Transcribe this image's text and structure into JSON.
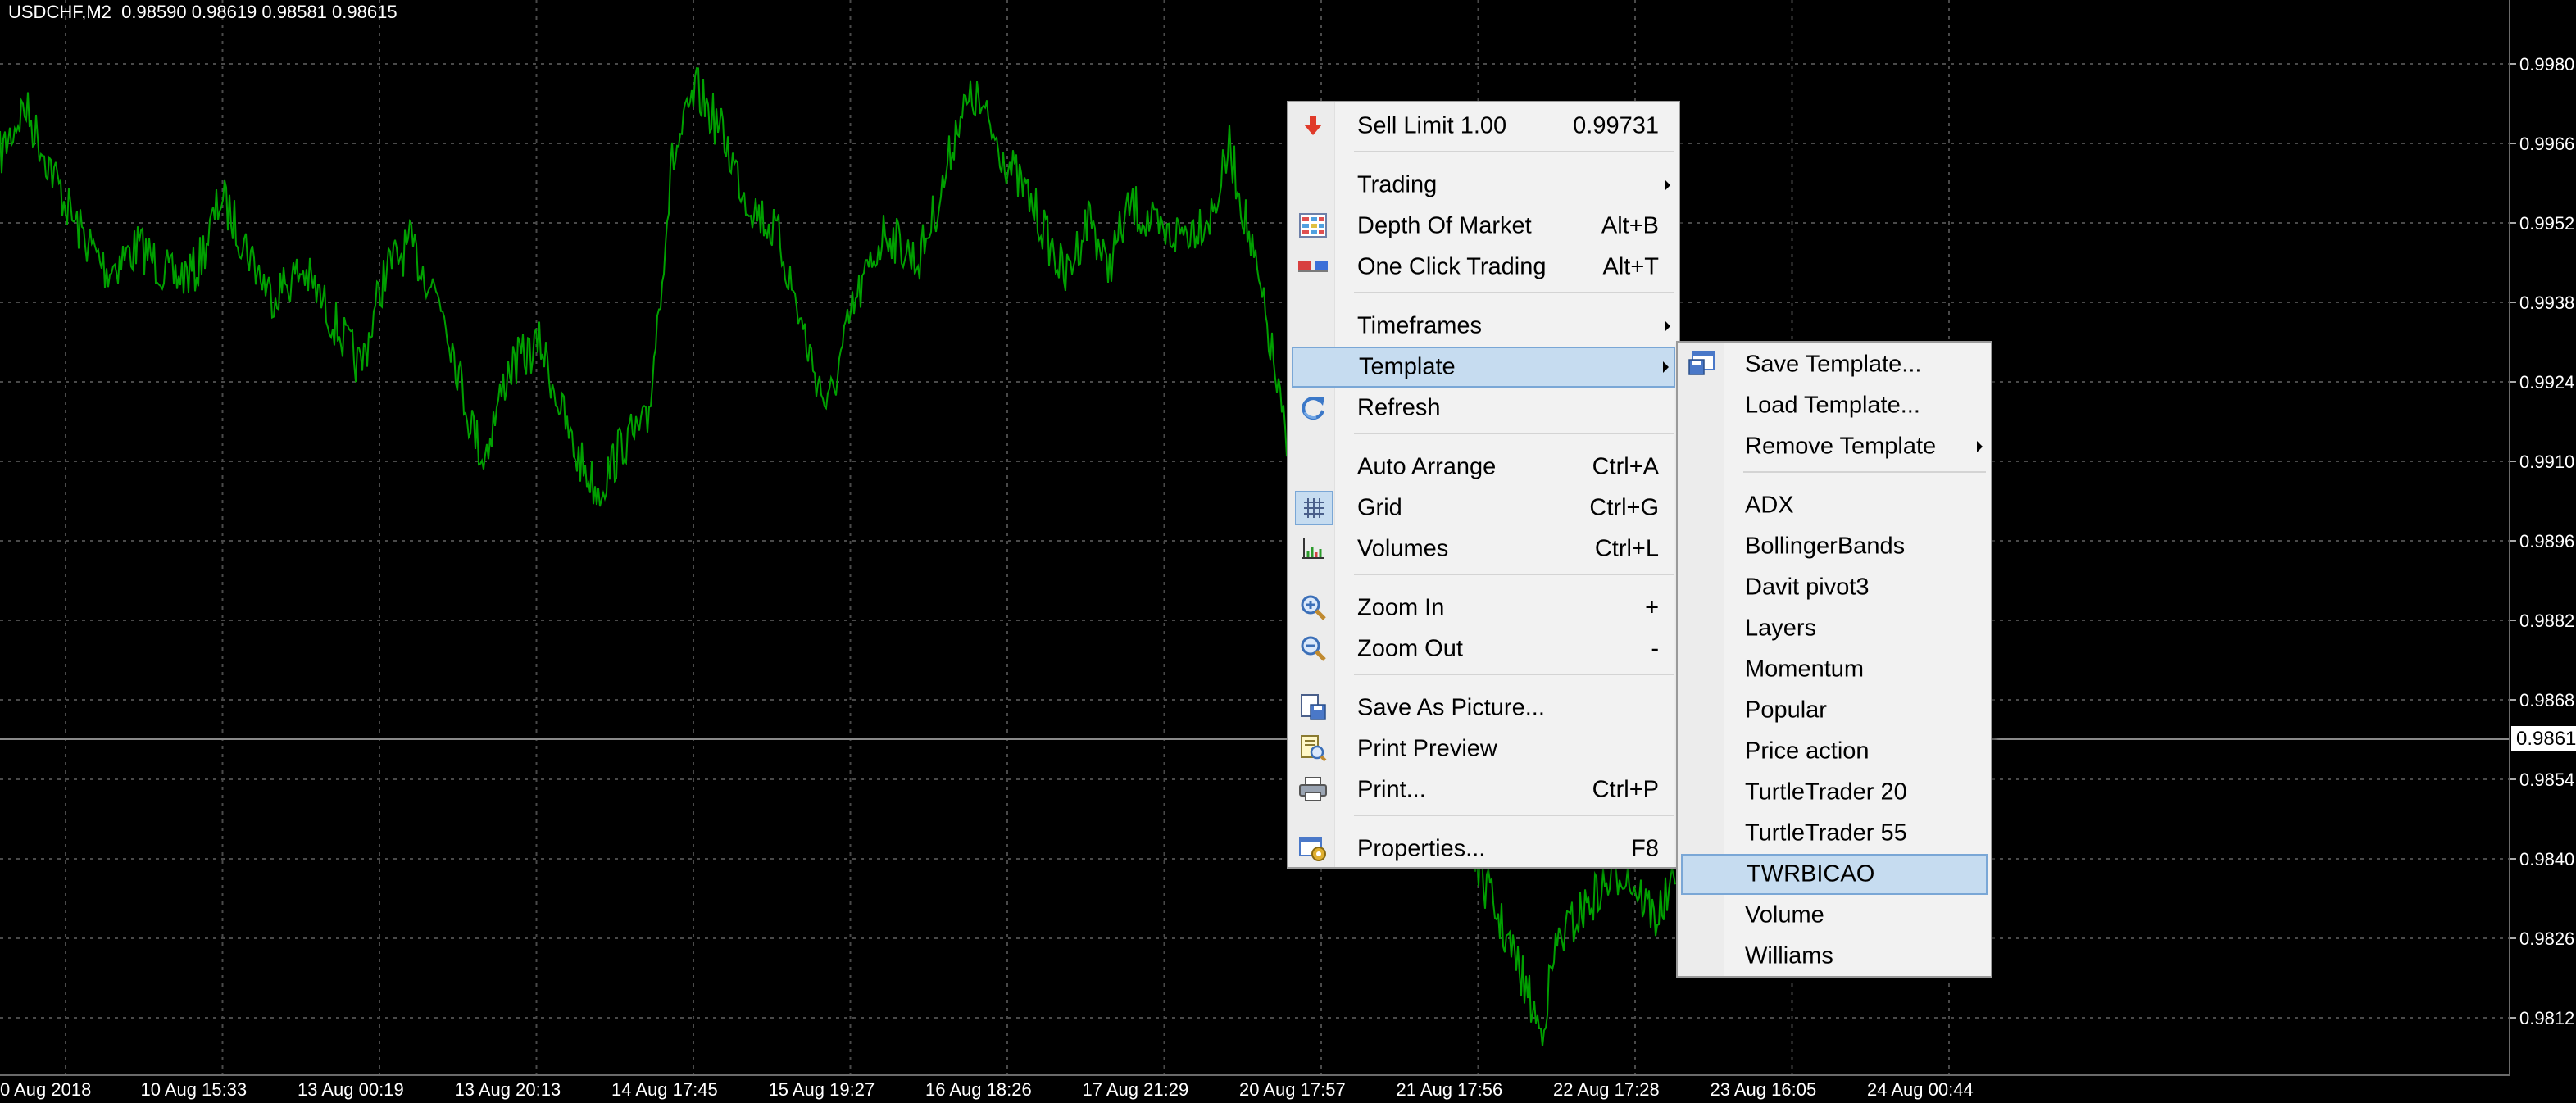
{
  "chart": {
    "symbol_info": "USDCHF,M2  0.98590 0.98619 0.98581 0.98615",
    "line_color": "#00a000",
    "grid_color": "#4a4a4a",
    "background": "#000000",
    "current_price_label": "0.9861",
    "y_ticks": [
      "0.9980",
      "0.9966",
      "0.9952",
      "0.9938",
      "0.9924",
      "0.9910",
      "0.9896",
      "0.9882",
      "0.9868",
      "0.9854",
      "0.9840",
      "0.9826",
      "0.9812"
    ],
    "x_ticks": [
      "0 Aug 2018",
      "10 Aug 15:33",
      "13 Aug 00:19",
      "13 Aug 20:13",
      "14 Aug 17:45",
      "15 Aug 19:27",
      "16 Aug 18:26",
      "17 Aug 21:29",
      "20 Aug 17:57",
      "21 Aug 17:56",
      "22 Aug 17:28",
      "23 Aug 16:05",
      "24 Aug 00:44"
    ]
  },
  "context_menu": {
    "items": [
      {
        "type": "item",
        "name": "sell-limit",
        "icon": "sell-arrow-icon",
        "label": "Sell Limit 1.00",
        "shortcut": "0.99731",
        "submenu": false
      },
      {
        "type": "sep"
      },
      {
        "type": "item",
        "name": "trading",
        "icon": "",
        "label": "Trading",
        "shortcut": "",
        "submenu": true
      },
      {
        "type": "item",
        "name": "depth-of-market",
        "icon": "depth-of-market-icon",
        "label": "Depth Of Market",
        "shortcut": "Alt+B",
        "submenu": false
      },
      {
        "type": "item",
        "name": "one-click-trading",
        "icon": "one-click-trading-icon",
        "label": "One Click Trading",
        "shortcut": "Alt+T",
        "submenu": false
      },
      {
        "type": "sep"
      },
      {
        "type": "item",
        "name": "timeframes",
        "icon": "",
        "label": "Timeframes",
        "shortcut": "",
        "submenu": true
      },
      {
        "type": "item",
        "name": "template",
        "icon": "",
        "label": "Template",
        "shortcut": "",
        "submenu": true,
        "highlighted": true
      },
      {
        "type": "item",
        "name": "refresh",
        "icon": "refresh-icon",
        "label": "Refresh",
        "shortcut": "",
        "submenu": false
      },
      {
        "type": "sep"
      },
      {
        "type": "item",
        "name": "auto-arrange",
        "icon": "",
        "label": "Auto Arrange",
        "shortcut": "Ctrl+A",
        "submenu": false
      },
      {
        "type": "item",
        "name": "grid",
        "icon": "grid-icon",
        "label": "Grid",
        "shortcut": "Ctrl+G",
        "submenu": false,
        "checked": true
      },
      {
        "type": "item",
        "name": "volumes",
        "icon": "volumes-icon",
        "label": "Volumes",
        "shortcut": "Ctrl+L",
        "submenu": false
      },
      {
        "type": "sep"
      },
      {
        "type": "item",
        "name": "zoom-in",
        "icon": "zoom-in-icon",
        "label": "Zoom In",
        "shortcut": "+",
        "submenu": false
      },
      {
        "type": "item",
        "name": "zoom-out",
        "icon": "zoom-out-icon",
        "label": "Zoom Out",
        "shortcut": "-",
        "submenu": false
      },
      {
        "type": "sep"
      },
      {
        "type": "item",
        "name": "save-as-picture",
        "icon": "save-picture-icon",
        "label": "Save As Picture...",
        "shortcut": "",
        "submenu": false
      },
      {
        "type": "item",
        "name": "print-preview",
        "icon": "print-preview-icon",
        "label": "Print Preview",
        "shortcut": "",
        "submenu": false
      },
      {
        "type": "item",
        "name": "print",
        "icon": "printer-icon",
        "label": "Print...",
        "shortcut": "Ctrl+P",
        "submenu": false
      },
      {
        "type": "sep"
      },
      {
        "type": "item",
        "name": "properties",
        "icon": "properties-icon",
        "label": "Properties...",
        "shortcut": "F8",
        "submenu": false
      }
    ]
  },
  "template_submenu": {
    "items": [
      {
        "type": "item",
        "name": "save-template",
        "icon": "save-template-icon",
        "label": "Save Template...",
        "submenu": false
      },
      {
        "type": "item",
        "name": "load-template",
        "icon": "",
        "label": "Load Template...",
        "submenu": false
      },
      {
        "type": "item",
        "name": "remove-template",
        "icon": "",
        "label": "Remove Template",
        "submenu": true
      },
      {
        "type": "sep"
      },
      {
        "type": "item",
        "name": "template-adx",
        "label": "ADX"
      },
      {
        "type": "item",
        "name": "template-bollingerbands",
        "label": "BollingerBands"
      },
      {
        "type": "item",
        "name": "template-davit-pivot3",
        "label": "Davit  pivot3"
      },
      {
        "type": "item",
        "name": "template-layers",
        "label": "Layers"
      },
      {
        "type": "item",
        "name": "template-momentum",
        "label": "Momentum"
      },
      {
        "type": "item",
        "name": "template-popular",
        "label": "Popular"
      },
      {
        "type": "item",
        "name": "template-price-action",
        "label": "Price action"
      },
      {
        "type": "item",
        "name": "template-turtletrader-20",
        "label": "TurtleTrader 20"
      },
      {
        "type": "item",
        "name": "template-turtletrader-55",
        "label": "TurtleTrader 55"
      },
      {
        "type": "item",
        "name": "template-twrbicao",
        "label": "TWRBICAO",
        "highlighted": true
      },
      {
        "type": "item",
        "name": "template-volume",
        "label": "Volume"
      },
      {
        "type": "item",
        "name": "template-williams",
        "label": "Williams"
      }
    ]
  }
}
